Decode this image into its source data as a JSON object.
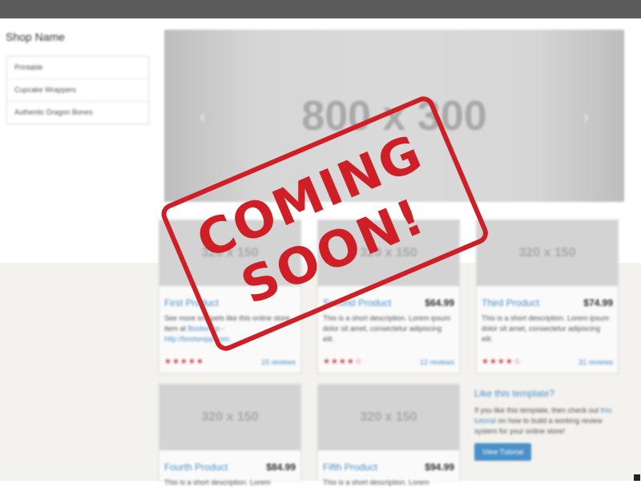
{
  "sidebar": {
    "title": "Shop Name",
    "items": [
      {
        "label": "Printable"
      },
      {
        "label": "Cupcake Wrappers"
      },
      {
        "label": "Authentic Dragon Bones"
      }
    ]
  },
  "carousel": {
    "placeholder": "800 x 300",
    "prev_icon": "chevron-left-icon",
    "next_icon": "chevron-right-icon",
    "prev_glyph": "‹",
    "next_glyph": "›"
  },
  "products": [
    {
      "title": "First Product",
      "price": "",
      "thumb": "320 x 150",
      "desc_parts": [
        "See more snippets like this online store item at ",
        "Bootsnipp",
        " - ",
        "http://bootsnipp.com",
        "."
      ],
      "stars": "★★★★★",
      "reviews": "15 reviews"
    },
    {
      "title": "Second Product",
      "price": "$64.99",
      "thumb": "320 x 150",
      "desc": "This is a short description. Lorem ipsum dolor sit amet, consectetur adipiscing elit.",
      "stars": "★★★★☆",
      "reviews": "12 reviews"
    },
    {
      "title": "Third Product",
      "price": "$74.99",
      "thumb": "320 x 150",
      "desc": "This is a short description. Lorem ipsum dolor sit amet, consectetur adipiscing elit.",
      "stars": "★★★★☆",
      "reviews": "31 reviews"
    },
    {
      "title": "Fourth Product",
      "price": "$84.99",
      "thumb": "320 x 150",
      "desc": "This is a short description. Lorem"
    },
    {
      "title": "Fifth Product",
      "price": "$94.99",
      "thumb": "320 x 150",
      "desc": "This is a short description. Lorem"
    }
  ],
  "promo": {
    "title": "Like this template?",
    "text_before": "If you like this template, then check out ",
    "link": "this tutorial",
    "text_after": " on how to build a working review system for your online store!",
    "button": "View Tutorial"
  },
  "stamp": {
    "line1": "COMING",
    "line2": "SOON!"
  },
  "colors": {
    "brand": "#4a90c9",
    "stamp_red": "#cf1f26",
    "navbar": "#5b5b5b",
    "star": "#c9444f"
  }
}
